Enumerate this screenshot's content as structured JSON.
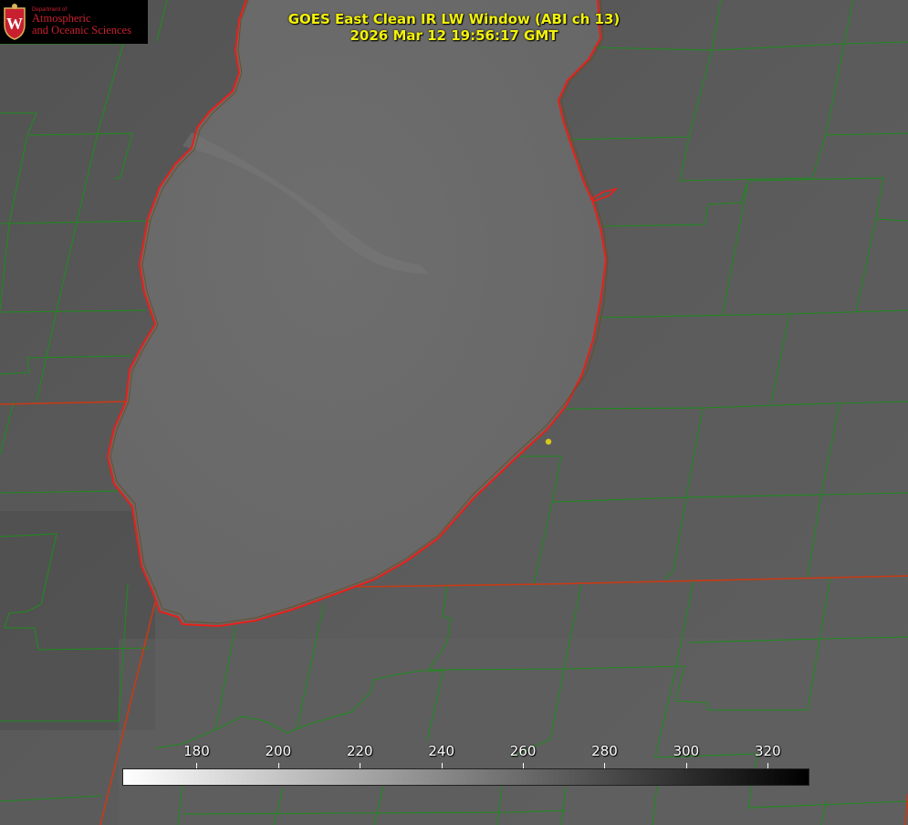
{
  "title": {
    "line1": "GOES East Clean IR LW Window (ABI ch 13)",
    "line2": "2026 Mar 12 19:56:17 GMT"
  },
  "logo": {
    "small": "Department of",
    "line1": "Atmospheric",
    "line2": "and Oceanic Sciences",
    "seal_letter": "W"
  },
  "colorbar": {
    "min": 162,
    "max": 330,
    "ticks": [
      "180",
      "200",
      "220",
      "240",
      "260",
      "280",
      "300",
      "320"
    ],
    "tick_values": [
      180,
      200,
      220,
      240,
      260,
      280,
      300,
      320
    ],
    "gradient": [
      "#ffffff",
      "#000000"
    ]
  },
  "colors": {
    "county_lines": "#1f8a1f",
    "state_lines": "#c83a14",
    "shoreline": "#e8201a",
    "title_text": "#f2f20a",
    "marker": "#d8c81a",
    "logo_red": "#c8202f"
  }
}
